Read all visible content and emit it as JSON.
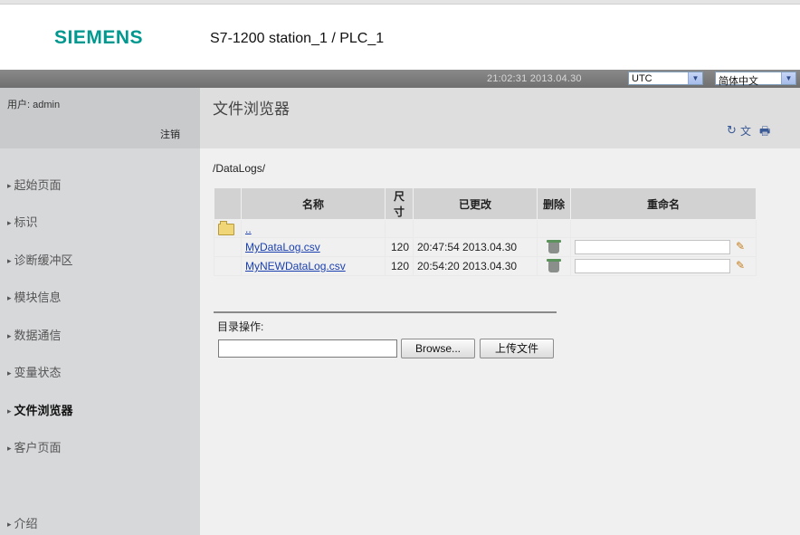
{
  "header": {
    "brand": "SIEMENS",
    "station": "S7-1200 station_1 / PLC_1"
  },
  "statusbar": {
    "time": "21:02:31",
    "date": "2013.04.30",
    "timezone": "UTC",
    "language": "简体中文"
  },
  "sidebar": {
    "user_label": "用户: admin",
    "logout": "注销",
    "items": [
      {
        "label": "起始页面",
        "active": false
      },
      {
        "label": "标识",
        "active": false
      },
      {
        "label": "诊断缓冲区",
        "active": false
      },
      {
        "label": "模块信息",
        "active": false
      },
      {
        "label": "数据通信",
        "active": false
      },
      {
        "label": "变量状态",
        "active": false
      },
      {
        "label": "文件浏览器",
        "active": true
      },
      {
        "label": "客户页面",
        "active": false
      },
      {
        "label": "介绍",
        "active": false
      }
    ]
  },
  "main": {
    "title": "文件浏览器",
    "path": "/DataLogs/",
    "columns": [
      "名称",
      "尺寸",
      "已更改",
      "删除",
      "重命名"
    ],
    "parent_link": "..",
    "files": [
      {
        "name": "MyDataLog.csv",
        "size": "120",
        "modified": "20:47:54 2013.04.30"
      },
      {
        "name": "MyNEWDataLog.csv",
        "size": "120",
        "modified": "20:54:20 2013.04.30"
      }
    ],
    "dir_ops_label": "目录操作:",
    "browse_button": "Browse...",
    "upload_button": "上传文件"
  },
  "icons": {
    "refresh": "refresh-icon",
    "language": "language-icon",
    "print": "print-icon",
    "folder": "folder-icon",
    "trash": "trash-icon",
    "pencil": "pencil-icon"
  },
  "colors": {
    "brand": "#00988f",
    "link": "#1a3fae",
    "statusbar": "#7a7a7a"
  }
}
